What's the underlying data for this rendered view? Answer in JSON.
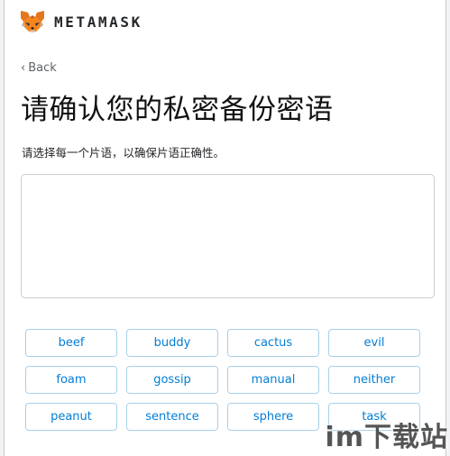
{
  "header": {
    "brand": "METAMASK",
    "logo_icon": "metamask-fox-icon"
  },
  "nav": {
    "back_label": "Back",
    "back_icon": "chevron-left-icon"
  },
  "page": {
    "title": "请确认您的私密备份密语",
    "subtitle": "请选择每一个片语，以确保片语正确性。"
  },
  "phrase_box": {
    "selected_words": []
  },
  "word_options": [
    "beef",
    "buddy",
    "cactus",
    "evil",
    "foam",
    "gossip",
    "manual",
    "neither",
    "peanut",
    "sentence",
    "sphere",
    "task"
  ],
  "watermark": {
    "text": "im下载站"
  },
  "colors": {
    "accent": "#037dd6",
    "word_border": "#a9d0ea",
    "box_border": "#c8cdd2",
    "text": "#24272a"
  }
}
